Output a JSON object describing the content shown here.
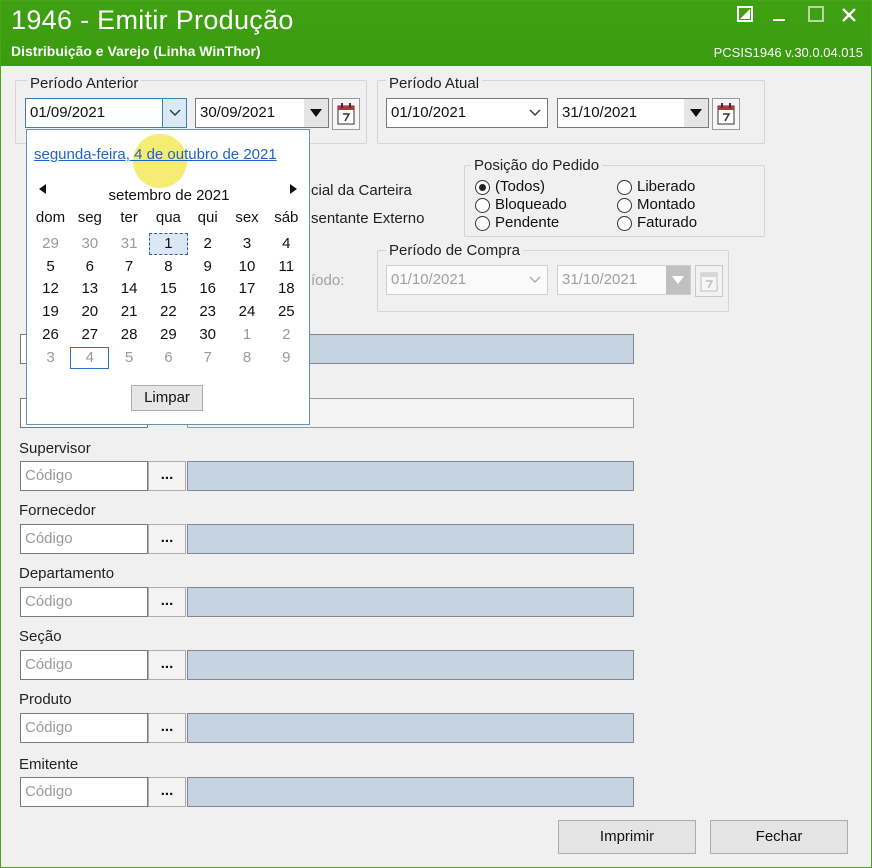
{
  "window": {
    "title": "1946 - Emitir Produção",
    "subtitle": "Distribuição e Varejo (Linha WinThor)",
    "version": "PCSIS1946  v.30.0.04.015"
  },
  "periodo_anterior": {
    "label": "Período Anterior",
    "start": "01/09/2021",
    "end": "30/09/2021"
  },
  "periodo_atual": {
    "label": "Período Atual",
    "start": "01/10/2021",
    "end": "31/10/2021"
  },
  "partial_labels": {
    "carteira": "cial da Carteira",
    "representante": "sentante Externo",
    "periodo": "íodo:"
  },
  "posicao_pedido": {
    "label": "Posição do Pedido",
    "options": [
      {
        "label": "(Todos)",
        "checked": true
      },
      {
        "label": "Bloqueado",
        "checked": false
      },
      {
        "label": "Pendente",
        "checked": false
      },
      {
        "label": "Liberado",
        "checked": false
      },
      {
        "label": "Montado",
        "checked": false
      },
      {
        "label": "Faturado",
        "checked": false
      }
    ]
  },
  "periodo_compra": {
    "label": "Período de Compra",
    "start": "01/10/2021",
    "end": "31/10/2021"
  },
  "calendar": {
    "today_link": "segunda-feira, 4 de outubro de 2021",
    "month_title": "setembro de 2021",
    "weekdays": [
      "dom",
      "seg",
      "ter",
      "qua",
      "qui",
      "sex",
      "sáb"
    ],
    "weeks": [
      [
        "29",
        "30",
        "31",
        "1",
        "2",
        "3",
        "4"
      ],
      [
        "5",
        "6",
        "7",
        "8",
        "9",
        "10",
        "11"
      ],
      [
        "12",
        "13",
        "14",
        "15",
        "16",
        "17",
        "18"
      ],
      [
        "19",
        "20",
        "21",
        "22",
        "23",
        "24",
        "25"
      ],
      [
        "26",
        "27",
        "28",
        "29",
        "30",
        "1",
        "2"
      ],
      [
        "3",
        "4",
        "5",
        "6",
        "7",
        "8",
        "9"
      ]
    ],
    "clear_label": "Limpar"
  },
  "filters": [
    {
      "label": "",
      "placeholder": ""
    },
    {
      "label": "",
      "placeholder": ""
    },
    {
      "label": "Supervisor",
      "placeholder": "Código",
      "ellipsis": "..."
    },
    {
      "label": "Fornecedor",
      "placeholder": "Código",
      "ellipsis": "..."
    },
    {
      "label": "Departamento",
      "placeholder": "Código",
      "ellipsis": "..."
    },
    {
      "label": "Seção",
      "placeholder": "Código",
      "ellipsis": "..."
    },
    {
      "label": "Produto",
      "placeholder": "Código",
      "ellipsis": "..."
    },
    {
      "label": "Emitente",
      "placeholder": "Código",
      "ellipsis": "..."
    }
  ],
  "buttons": {
    "print": "Imprimir",
    "close": "Fechar"
  },
  "colors": {
    "titlebar": "#3fa112",
    "description_field": "#c6d3e1",
    "link": "#1e64c8",
    "highlight": "#f0e428"
  }
}
